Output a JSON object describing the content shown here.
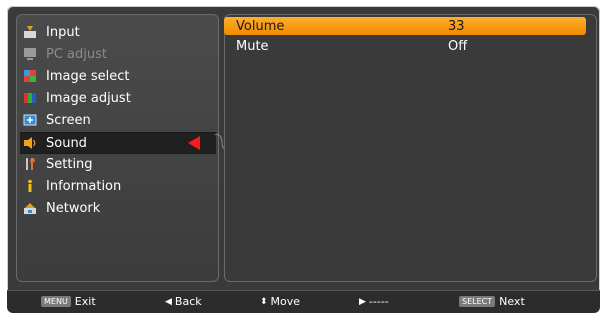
{
  "menu": {
    "items": [
      {
        "label": "Input",
        "icon": "input-icon",
        "state": "normal"
      },
      {
        "label": "PC adjust",
        "icon": "monitor-icon",
        "state": "disabled"
      },
      {
        "label": "Image select",
        "icon": "image-select-icon",
        "state": "normal"
      },
      {
        "label": "Image adjust",
        "icon": "image-adjust-icon",
        "state": "normal"
      },
      {
        "label": "Screen",
        "icon": "screen-icon",
        "state": "normal"
      },
      {
        "label": "Sound",
        "icon": "sound-icon",
        "state": "selected"
      },
      {
        "label": "Setting",
        "icon": "setting-icon",
        "state": "normal"
      },
      {
        "label": "Information",
        "icon": "information-icon",
        "state": "normal"
      },
      {
        "label": "Network",
        "icon": "network-icon",
        "state": "normal"
      }
    ]
  },
  "submenu": {
    "rows": [
      {
        "name": "Volume",
        "value": "33",
        "highlighted": true
      },
      {
        "name": "Mute",
        "value": "Off",
        "highlighted": false
      }
    ]
  },
  "footer": {
    "exit_key": "MENU",
    "exit_label": "Exit",
    "back_label": "Back",
    "move_label": "Move",
    "play_label": "-----",
    "next_key": "SELECT",
    "next_label": "Next"
  },
  "colors": {
    "highlight": "#f39200",
    "selection_arrow": "#ff1a1a",
    "panel": "#3a3a3a"
  }
}
